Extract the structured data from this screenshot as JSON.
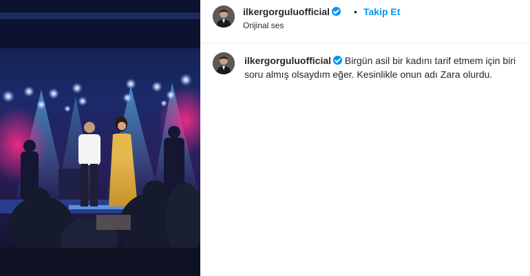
{
  "post": {
    "username": "ilkergorguluofficial",
    "separator": "•",
    "follow_label": "Takip Et",
    "audio_label": "Orijinal ses",
    "caption": "Birgün asil bir kadını tarif etmem için biri soru almış olsaydım eğer. Kesinlikle onun adı Zara olurdu."
  },
  "icons": {
    "verified": "verified-badge-icon",
    "avatar": "profile-avatar"
  },
  "colors": {
    "accent": "#0095f6",
    "text": "#262626",
    "stage_background": "#1a2a6a",
    "singer_dress": "#d9a93c"
  }
}
